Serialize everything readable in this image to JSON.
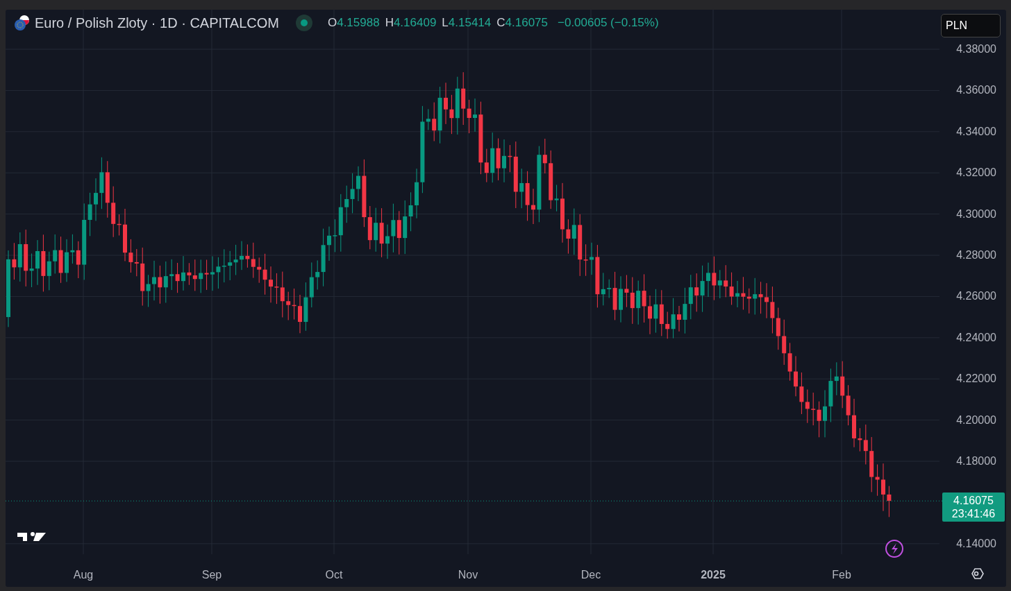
{
  "header": {
    "symbol": "Euro / Polish Zloty · 1D · CAPITALCOM",
    "market_open": true,
    "ohlc": [
      {
        "label": "O",
        "value": "4.15988"
      },
      {
        "label": "H",
        "value": "4.16409"
      },
      {
        "label": "L",
        "value": "4.15414"
      },
      {
        "label": "C",
        "value": "4.16075"
      }
    ],
    "change": "−0.00605 (−0.15%)"
  },
  "currency_select": {
    "value": "PLN"
  },
  "price_axis": {
    "ticks": [
      "4.38000",
      "4.36000",
      "4.34000",
      "4.32000",
      "4.30000",
      "4.28000",
      "4.26000",
      "4.24000",
      "4.22000",
      "4.20000",
      "4.18000",
      "4.14000"
    ]
  },
  "last_price": {
    "price": "4.16075",
    "countdown": "23:41:46"
  },
  "time_axis": {
    "labels": [
      {
        "text": "Aug",
        "bold": false
      },
      {
        "text": "Sep",
        "bold": false
      },
      {
        "text": "Oct",
        "bold": false
      },
      {
        "text": "Nov",
        "bold": false
      },
      {
        "text": "Dec",
        "bold": false
      },
      {
        "text": "2025",
        "bold": true
      },
      {
        "text": "Feb",
        "bold": false
      }
    ]
  }
}
